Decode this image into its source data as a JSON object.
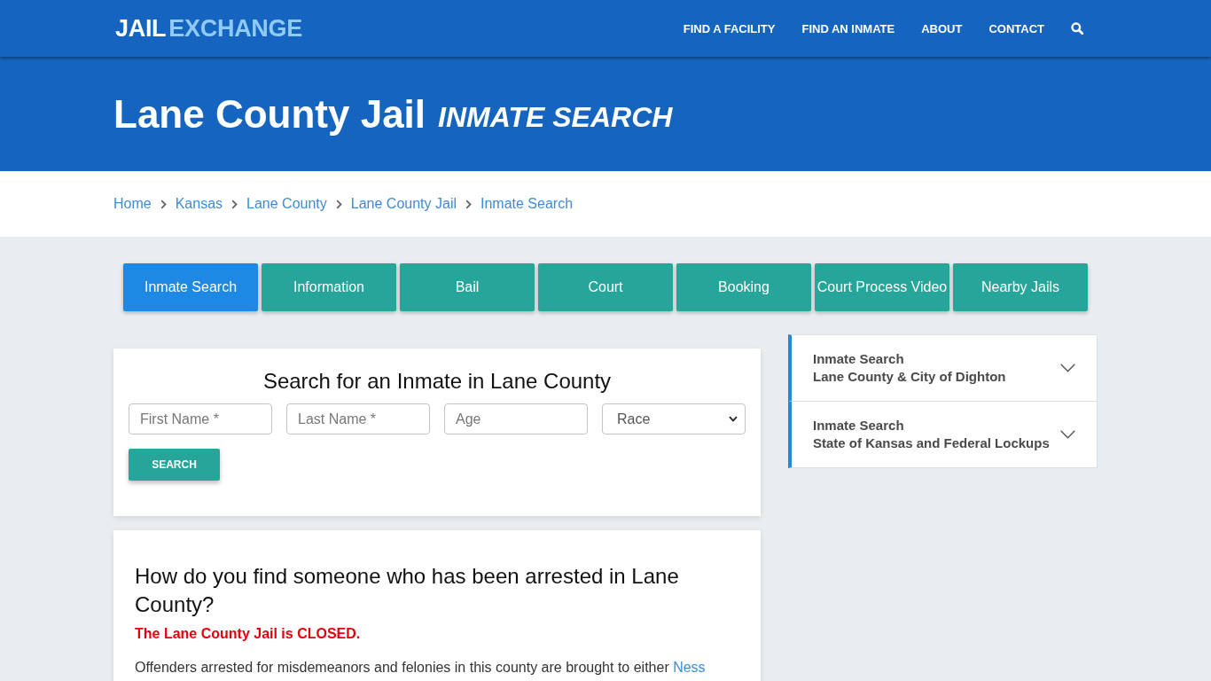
{
  "header": {
    "logo": {
      "primary": "JAIL",
      "accent": "EXCHANGE"
    },
    "nav": [
      "FIND A FACILITY",
      "FIND AN INMATE",
      "ABOUT",
      "CONTACT"
    ]
  },
  "hero": {
    "title": "Lane County Jail",
    "subtitle": "INMATE SEARCH"
  },
  "breadcrumb": [
    "Home",
    "Kansas",
    "Lane County",
    "Lane County Jail",
    "Inmate Search"
  ],
  "tabs": [
    {
      "label": "Inmate Search",
      "selected": true
    },
    {
      "label": "Information",
      "selected": false
    },
    {
      "label": "Bail",
      "selected": false
    },
    {
      "label": "Court",
      "selected": false
    },
    {
      "label": "Booking",
      "selected": false
    },
    {
      "label": "Court Process Video",
      "selected": false
    },
    {
      "label": "Nearby Jails",
      "selected": false
    }
  ],
  "search_card": {
    "title": "Search for an Inmate in Lane County",
    "fields": [
      {
        "kind": "text",
        "placeholder": "First Name *"
      },
      {
        "kind": "text",
        "placeholder": "Last Name *"
      },
      {
        "kind": "text",
        "placeholder": "Age"
      },
      {
        "kind": "select",
        "value": "Race"
      }
    ],
    "button": "SEARCH"
  },
  "article": {
    "heading": "How do you find someone who has been arrested in Lane County?",
    "notice": "The Lane County Jail is CLOSED.",
    "paragraph": {
      "text": "Offenders arrested for misdemeanors and felonies in this county are brought to either",
      "link": "Ness"
    }
  },
  "sidebar": {
    "items": [
      {
        "title": "Inmate Search",
        "subtitle": "Lane County & City of Dighton",
        "expanded": false
      },
      {
        "title": "Inmate Search",
        "subtitle": "State of Kansas and Federal Lockups",
        "expanded": false
      }
    ]
  }
}
